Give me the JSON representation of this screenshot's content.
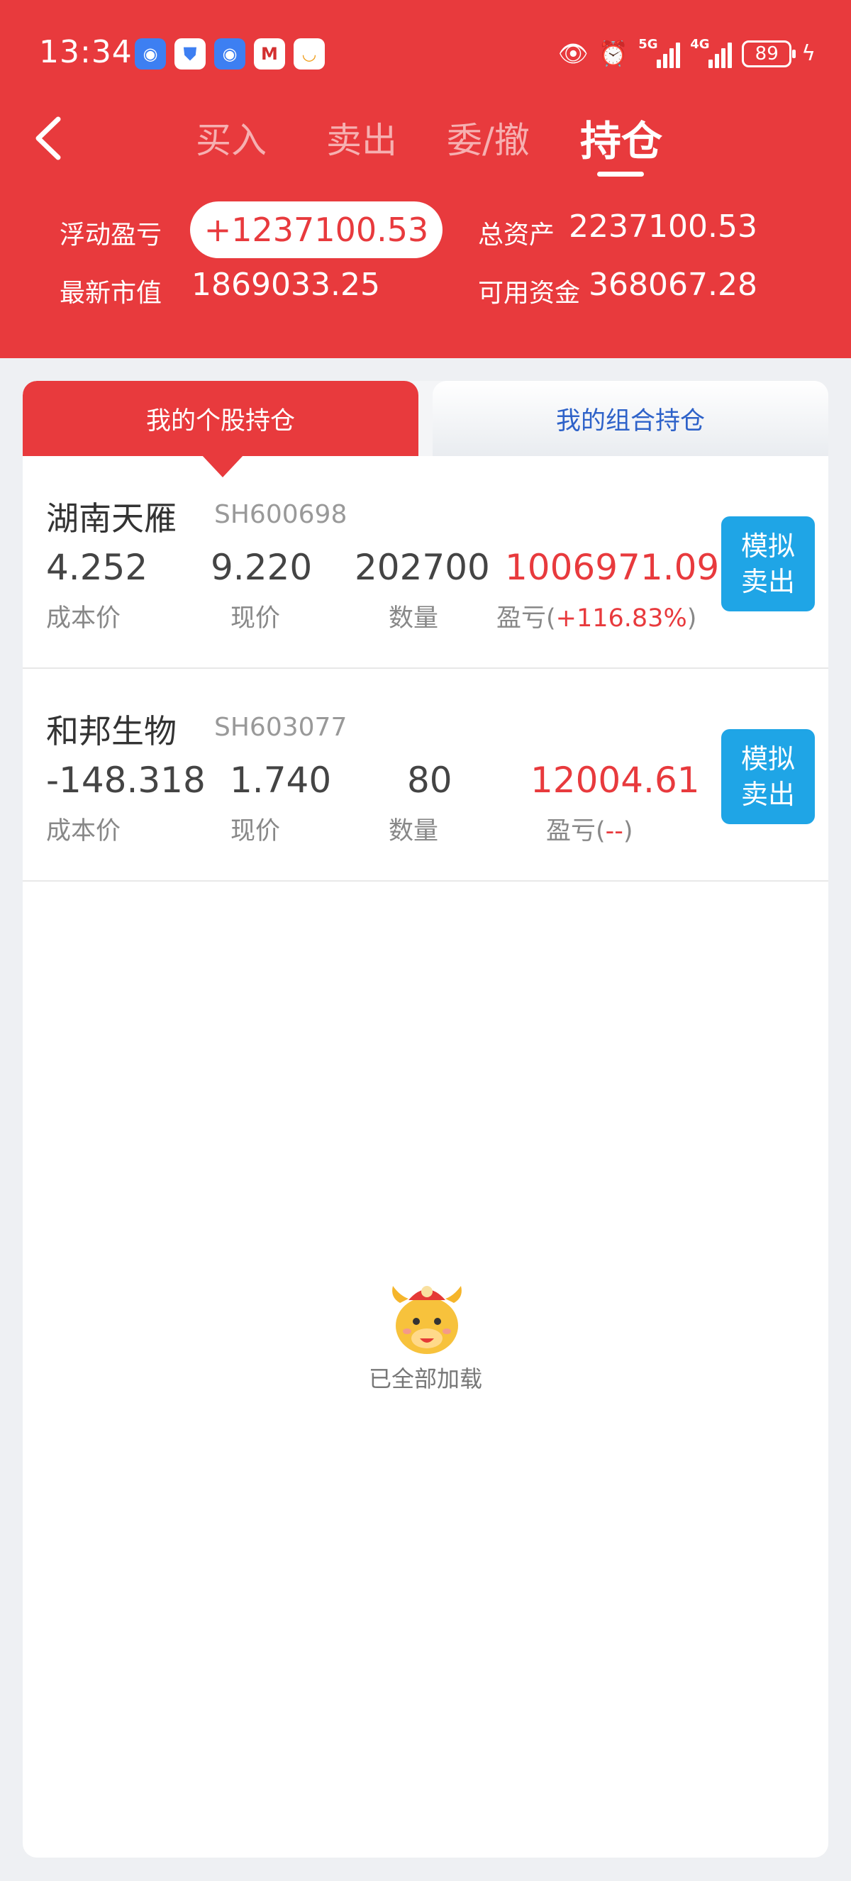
{
  "status_bar": {
    "time": "13:34",
    "battery": "89",
    "signal_5g": "5G",
    "signal_4g": "4G"
  },
  "nav": {
    "tabs": [
      {
        "label": "买入"
      },
      {
        "label": "卖出"
      },
      {
        "label": "委/撤"
      },
      {
        "label": "持仓"
      }
    ]
  },
  "summary": {
    "floating_pnl_label": "浮动盈亏",
    "floating_pnl_value": "+1237100.53",
    "total_assets_label": "总资产",
    "total_assets_value": "2237100.53",
    "market_value_label": "最新市值",
    "market_value_value": "1869033.25",
    "available_funds_label": "可用资金",
    "available_funds_value": "368067.28"
  },
  "segments": {
    "left": "我的个股持仓",
    "right": "我的组合持仓"
  },
  "labels": {
    "cost": "成本价",
    "price": "现价",
    "qty": "数量",
    "pnl_prefix": "盈亏(",
    "pnl_suffix": ")"
  },
  "holdings": [
    {
      "name": "湖南天雁",
      "code": "SH600698",
      "cost": "4.252",
      "price": "9.220",
      "qty": "202700",
      "pnl": "1006971.09",
      "pnl_pct": "+116.83%",
      "sell_label_1": "模拟",
      "sell_label_2": "卖出"
    },
    {
      "name": "和邦生物",
      "code": "SH603077",
      "cost": "-148.318",
      "price": "1.740",
      "qty": "80",
      "pnl": "12004.61",
      "pnl_pct": "--",
      "sell_label_1": "模拟",
      "sell_label_2": "卖出"
    }
  ],
  "footer": {
    "loaded_text": "已全部加载"
  },
  "colors": {
    "brand_red": "#e83a3d",
    "sell_blue": "#1fa5e6",
    "link_blue": "#2e62c9"
  }
}
